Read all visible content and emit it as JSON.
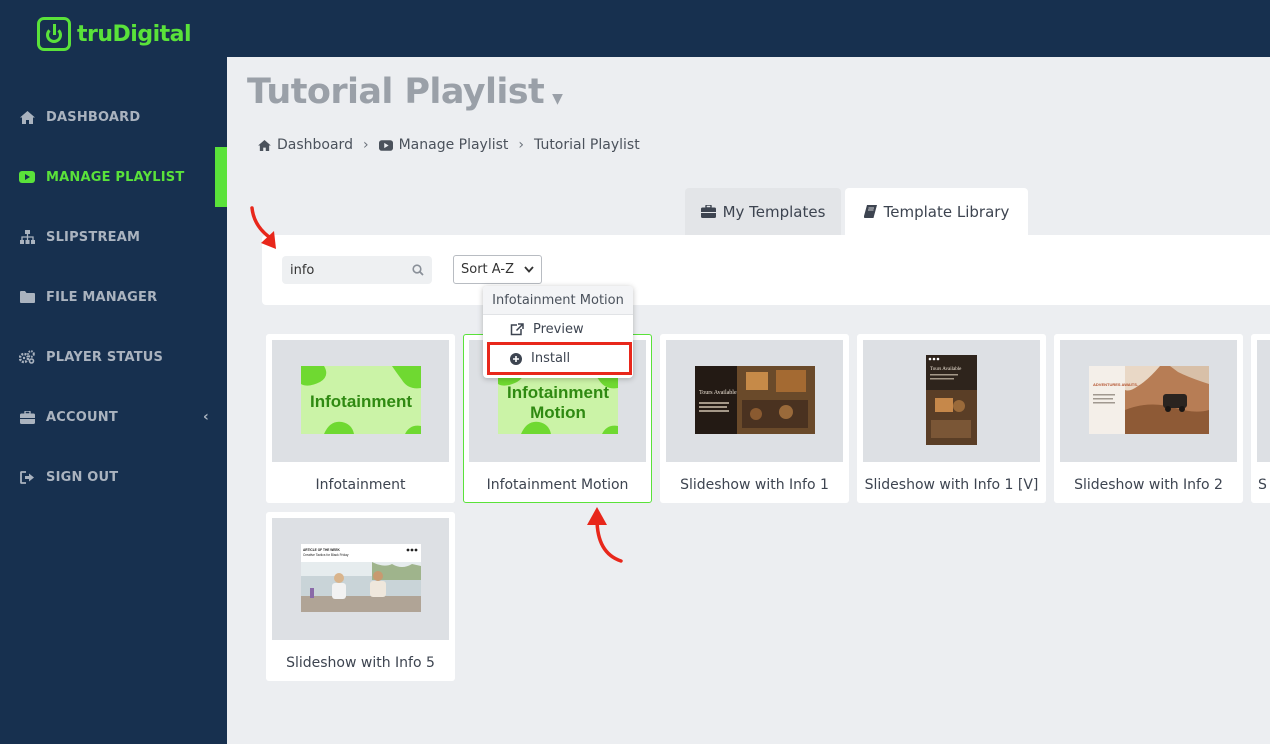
{
  "app": {
    "name": "truDigital"
  },
  "colors": {
    "sidebar": "#17304f",
    "accent": "#5ae23a",
    "annotation": "#e8271b"
  },
  "sidebar": {
    "items": [
      {
        "label": "DASHBOARD",
        "icon": "home-icon"
      },
      {
        "label": "MANAGE PLAYLIST",
        "icon": "play-icon",
        "active": true
      },
      {
        "label": "SLIPSTREAM",
        "icon": "sitemap-icon"
      },
      {
        "label": "FILE MANAGER",
        "icon": "folder-icon"
      },
      {
        "label": "PLAYER STATUS",
        "icon": "gears-icon"
      },
      {
        "label": "ACCOUNT",
        "icon": "briefcase-icon",
        "chevron": "‹"
      },
      {
        "label": "SIGN OUT",
        "icon": "sign-out-icon"
      }
    ]
  },
  "page": {
    "title": "Tutorial Playlist"
  },
  "breadcrumb": [
    {
      "label": "Dashboard",
      "icon": "home-icon"
    },
    {
      "label": "Manage Playlist",
      "icon": "play-icon"
    },
    {
      "label": "Tutorial Playlist"
    }
  ],
  "tabs": [
    {
      "label": "My Templates",
      "icon": "briefcase-icon"
    },
    {
      "label": "Template Library",
      "icon": "book-icon",
      "active": true
    }
  ],
  "search": {
    "value": "info"
  },
  "sort": {
    "selected": "Sort A-Z"
  },
  "popover": {
    "title": "Infotainment Motion",
    "preview": "Preview",
    "install": "Install"
  },
  "templates": [
    {
      "label": "Infotainment",
      "thumb_text": "Infotainment"
    },
    {
      "label": "Infotainment Motion",
      "thumb_text_1": "Infotainment",
      "thumb_text_2": "Motion",
      "selected": true
    },
    {
      "label": "Slideshow with Info 1",
      "thumb_text": "Tours Available"
    },
    {
      "label": "Slideshow with Info 1 [V]",
      "thumb_text": "Tours Available"
    },
    {
      "label": "Slideshow with Info 2",
      "thumb_text": "ADVENTURES AWAITS."
    },
    {
      "label": "S"
    },
    {
      "label": "Slideshow with Info 5",
      "thumb_text_1": "ARTICLE OF THE WEEK",
      "thumb_text_2": "Creative Tactics for Black Friday"
    }
  ]
}
